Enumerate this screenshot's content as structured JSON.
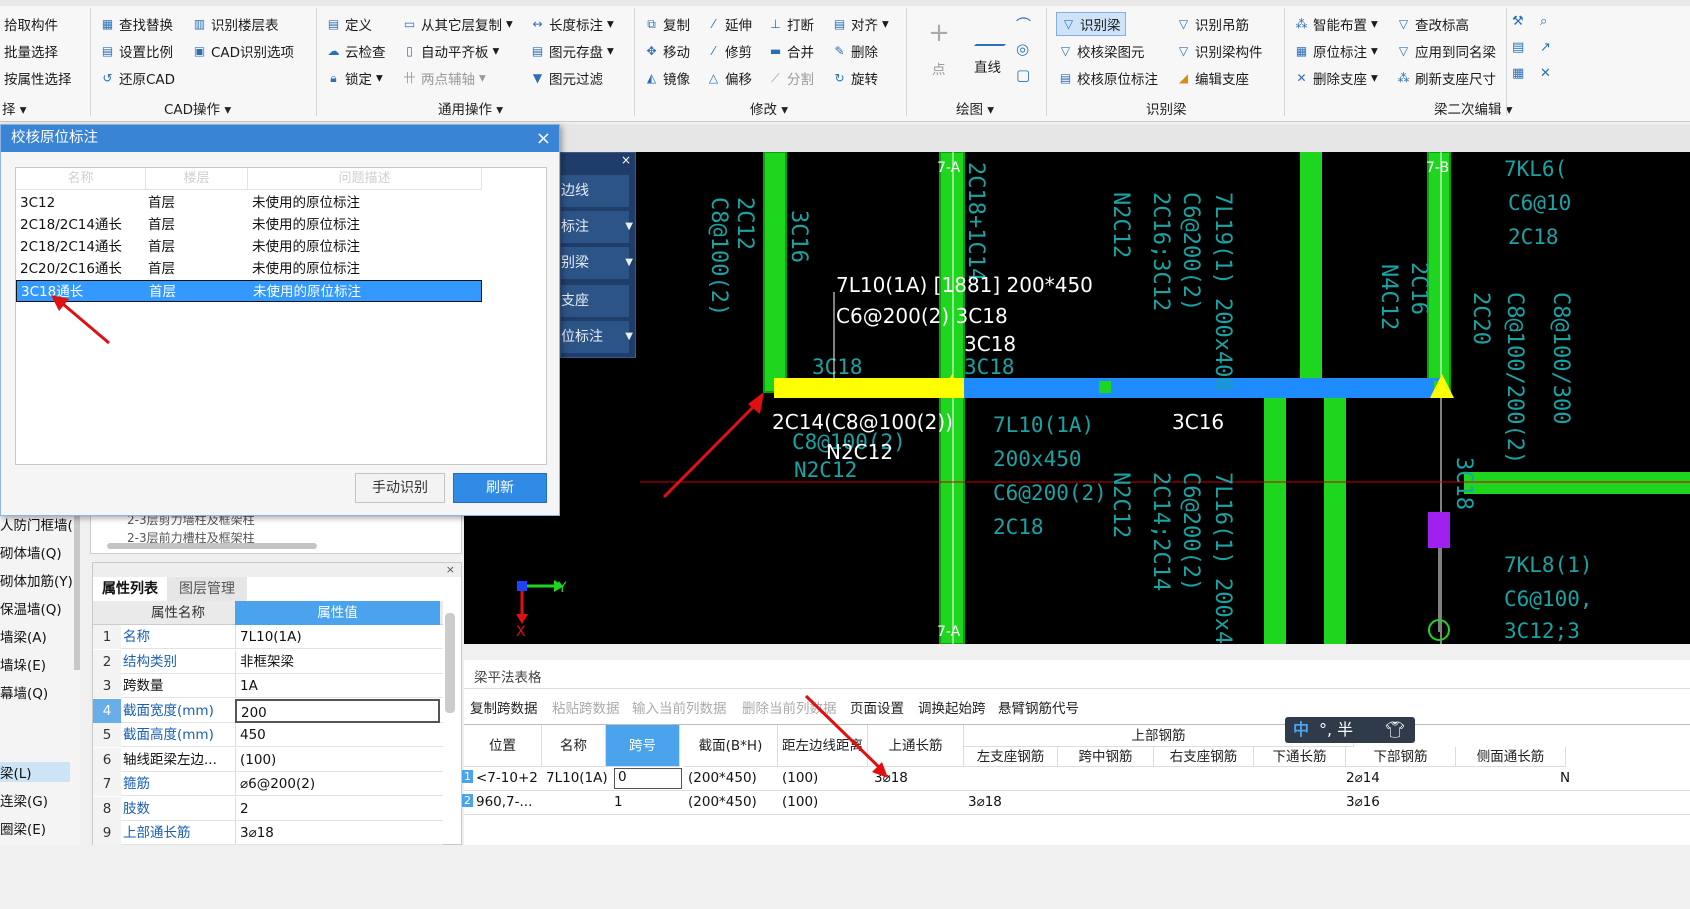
{
  "ribbon": {
    "col1": [
      "拾取构件",
      "批量选择",
      "按属性选择"
    ],
    "col1_group": "择",
    "col2": [
      "查找替换",
      "设置比例",
      "还原CAD"
    ],
    "col3": [
      "识别楼层表",
      "CAD识别选项"
    ],
    "cad_group": "CAD操作",
    "col4": [
      "定义",
      "云检查",
      "锁定"
    ],
    "col5": [
      "从其它层复制",
      "自动平齐板",
      "两点辅轴"
    ],
    "col6": [
      "长度标注",
      "图元存盘",
      "图元过滤"
    ],
    "common_group": "通用操作",
    "col7": [
      "复制",
      "移动",
      "镜像"
    ],
    "col8": [
      "延伸",
      "修剪",
      "偏移"
    ],
    "col9": [
      "打断",
      "合并",
      "分割"
    ],
    "col10": [
      "对齐",
      "删除",
      "旋转"
    ],
    "modify_group": "修改",
    "draw": {
      "point": "点",
      "line": "直线",
      "group": "绘图"
    },
    "col11": [
      "识别梁",
      "校核梁图元",
      "校核原位标注"
    ],
    "col12": [
      "识别吊筋",
      "识别梁构件",
      "编辑支座"
    ],
    "beam_group": "识别梁",
    "col13": [
      "智能布置",
      "原位标注",
      "删除支座"
    ],
    "col14": [
      "查改标高",
      "应用到同名梁",
      "刷新支座尺寸"
    ],
    "beam2_group": "梁二次编辑"
  },
  "dialog": {
    "title": "校核原位标注",
    "close": "×",
    "headers": [
      "名称",
      "楼层",
      "问题描述"
    ],
    "rows": [
      {
        "name": "3C12",
        "floor": "首层",
        "desc": "未使用的原位标注"
      },
      {
        "name": "2C18/2C14通长",
        "floor": "首层",
        "desc": "未使用的原位标注"
      },
      {
        "name": "2C18/2C14通长",
        "floor": "首层",
        "desc": "未使用的原位标注"
      },
      {
        "name": "2C20/2C16通长",
        "floor": "首层",
        "desc": "未使用的原位标注"
      },
      {
        "name": "3C18通长",
        "floor": "首层",
        "desc": "未使用的原位标注"
      }
    ],
    "manual_btn": "手动识别",
    "refresh_btn": "刷新"
  },
  "flyout": [
    "边线",
    "标注",
    "别梁",
    "支座",
    "位标注"
  ],
  "left_list": [
    "人防门框墙(",
    "砌体墙(Q)",
    "砌体加筋(Y)",
    "保温墙(Q)",
    "墙梁(A)",
    "墙垛(E)",
    "幕墙(Q)",
    "梁(L)",
    "连梁(G)",
    "圈梁(E)"
  ],
  "middle_list": [
    "2-3层剪力墙柱及框架柱",
    "2-3层前力槽柱及框架柱"
  ],
  "props": {
    "tabs": [
      "属性列表",
      "图层管理"
    ],
    "col_name": "属性名称",
    "col_value": "属性值",
    "rows": [
      {
        "n": "1",
        "name": "名称",
        "value": "7L10(1A)",
        "blue": true
      },
      {
        "n": "2",
        "name": "结构类别",
        "value": "非框架梁",
        "blue": true
      },
      {
        "n": "3",
        "name": "跨数量",
        "value": "1A",
        "blue": false
      },
      {
        "n": "4",
        "name": "截面宽度(mm)",
        "value": "200",
        "blue": true
      },
      {
        "n": "5",
        "name": "截面高度(mm)",
        "value": "450",
        "blue": true
      },
      {
        "n": "6",
        "name": "轴线距梁左边...",
        "value": "(100)",
        "blue": false
      },
      {
        "n": "7",
        "name": "箍筋",
        "value": "⌀6@200(2)",
        "blue": true
      },
      {
        "n": "8",
        "name": "肢数",
        "value": "2",
        "blue": true
      },
      {
        "n": "9",
        "name": "上部通长筋",
        "value": "3⌀18",
        "blue": true
      }
    ]
  },
  "cad": {
    "axis_7a": "7-A",
    "axis_7b": "7-B",
    "beam_label1": "7L10(1A) [1881] 200*450",
    "beam_label2": "C6@200(2) 3C18",
    "label_3c18": "3C18",
    "label_2c14": "2C14(C8@100(2))",
    "label_n2c12": "N2C12",
    "label_3c16": "3C16",
    "label_7l10": "7L10(1A)",
    "label_200x450": "200x450",
    "label_c6": "C6@200(2)",
    "label_2c18": "2C18",
    "label_7kl6": "7KL6(",
    "label_7kl8": "7KL8(1)"
  },
  "grid": {
    "title": "梁平法表格",
    "tools": [
      "复制跨数据",
      "粘贴跨数据",
      "输入当前列数据",
      "删除当前列数据",
      "页面设置",
      "调换起始跨",
      "悬臂钢筋代号"
    ],
    "tools_disabled": [
      false,
      true,
      true,
      true,
      false,
      false,
      false
    ],
    "headers": [
      "位置",
      "名称",
      "跨号",
      "截面(B*H)",
      "距左边线距离",
      "上通长筋",
      "左支座钢筋",
      "跨中钢筋",
      "右支座钢筋",
      "下通长筋",
      "下部钢筋",
      "侧面通长筋"
    ],
    "top_group": "上部钢筋",
    "side_group": "侧",
    "rows": [
      {
        "no": "1",
        "pos": "<7-10+2",
        "name": "7L10(1A)",
        "span": "0",
        "sec": "(200*450)",
        "dist": "(100)",
        "top": "3⌀18",
        "left": "",
        "mid": "",
        "right": "",
        "bot_through": "",
        "bot": "2⌀14",
        "side": "N"
      },
      {
        "no": "2",
        "pos": "960,7-...",
        "name": "",
        "span": "1",
        "sec": "(200*450)",
        "dist": "(100)",
        "top": "",
        "left": "3⌀18",
        "mid": "",
        "right": "",
        "bot_through": "",
        "bot": "3⌀16",
        "side": ""
      }
    ]
  },
  "ime": "中 °, 半"
}
